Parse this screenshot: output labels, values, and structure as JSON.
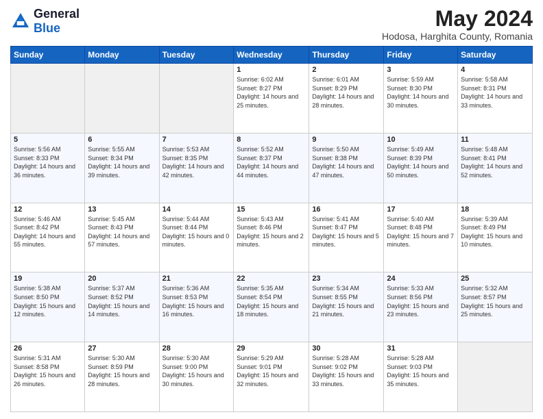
{
  "header": {
    "logo": {
      "general": "General",
      "blue": "Blue"
    },
    "title": "May 2024",
    "location": "Hodosa, Harghita County, Romania"
  },
  "weekdays": [
    "Sunday",
    "Monday",
    "Tuesday",
    "Wednesday",
    "Thursday",
    "Friday",
    "Saturday"
  ],
  "weeks": [
    [
      {
        "day": "",
        "info": ""
      },
      {
        "day": "",
        "info": ""
      },
      {
        "day": "",
        "info": ""
      },
      {
        "day": "1",
        "info": "Sunrise: 6:02 AM\nSunset: 8:27 PM\nDaylight: 14 hours and 25 minutes."
      },
      {
        "day": "2",
        "info": "Sunrise: 6:01 AM\nSunset: 8:29 PM\nDaylight: 14 hours and 28 minutes."
      },
      {
        "day": "3",
        "info": "Sunrise: 5:59 AM\nSunset: 8:30 PM\nDaylight: 14 hours and 30 minutes."
      },
      {
        "day": "4",
        "info": "Sunrise: 5:58 AM\nSunset: 8:31 PM\nDaylight: 14 hours and 33 minutes."
      }
    ],
    [
      {
        "day": "5",
        "info": "Sunrise: 5:56 AM\nSunset: 8:33 PM\nDaylight: 14 hours and 36 minutes."
      },
      {
        "day": "6",
        "info": "Sunrise: 5:55 AM\nSunset: 8:34 PM\nDaylight: 14 hours and 39 minutes."
      },
      {
        "day": "7",
        "info": "Sunrise: 5:53 AM\nSunset: 8:35 PM\nDaylight: 14 hours and 42 minutes."
      },
      {
        "day": "8",
        "info": "Sunrise: 5:52 AM\nSunset: 8:37 PM\nDaylight: 14 hours and 44 minutes."
      },
      {
        "day": "9",
        "info": "Sunrise: 5:50 AM\nSunset: 8:38 PM\nDaylight: 14 hours and 47 minutes."
      },
      {
        "day": "10",
        "info": "Sunrise: 5:49 AM\nSunset: 8:39 PM\nDaylight: 14 hours and 50 minutes."
      },
      {
        "day": "11",
        "info": "Sunrise: 5:48 AM\nSunset: 8:41 PM\nDaylight: 14 hours and 52 minutes."
      }
    ],
    [
      {
        "day": "12",
        "info": "Sunrise: 5:46 AM\nSunset: 8:42 PM\nDaylight: 14 hours and 55 minutes."
      },
      {
        "day": "13",
        "info": "Sunrise: 5:45 AM\nSunset: 8:43 PM\nDaylight: 14 hours and 57 minutes."
      },
      {
        "day": "14",
        "info": "Sunrise: 5:44 AM\nSunset: 8:44 PM\nDaylight: 15 hours and 0 minutes."
      },
      {
        "day": "15",
        "info": "Sunrise: 5:43 AM\nSunset: 8:46 PM\nDaylight: 15 hours and 2 minutes."
      },
      {
        "day": "16",
        "info": "Sunrise: 5:41 AM\nSunset: 8:47 PM\nDaylight: 15 hours and 5 minutes."
      },
      {
        "day": "17",
        "info": "Sunrise: 5:40 AM\nSunset: 8:48 PM\nDaylight: 15 hours and 7 minutes."
      },
      {
        "day": "18",
        "info": "Sunrise: 5:39 AM\nSunset: 8:49 PM\nDaylight: 15 hours and 10 minutes."
      }
    ],
    [
      {
        "day": "19",
        "info": "Sunrise: 5:38 AM\nSunset: 8:50 PM\nDaylight: 15 hours and 12 minutes."
      },
      {
        "day": "20",
        "info": "Sunrise: 5:37 AM\nSunset: 8:52 PM\nDaylight: 15 hours and 14 minutes."
      },
      {
        "day": "21",
        "info": "Sunrise: 5:36 AM\nSunset: 8:53 PM\nDaylight: 15 hours and 16 minutes."
      },
      {
        "day": "22",
        "info": "Sunrise: 5:35 AM\nSunset: 8:54 PM\nDaylight: 15 hours and 18 minutes."
      },
      {
        "day": "23",
        "info": "Sunrise: 5:34 AM\nSunset: 8:55 PM\nDaylight: 15 hours and 21 minutes."
      },
      {
        "day": "24",
        "info": "Sunrise: 5:33 AM\nSunset: 8:56 PM\nDaylight: 15 hours and 23 minutes."
      },
      {
        "day": "25",
        "info": "Sunrise: 5:32 AM\nSunset: 8:57 PM\nDaylight: 15 hours and 25 minutes."
      }
    ],
    [
      {
        "day": "26",
        "info": "Sunrise: 5:31 AM\nSunset: 8:58 PM\nDaylight: 15 hours and 26 minutes."
      },
      {
        "day": "27",
        "info": "Sunrise: 5:30 AM\nSunset: 8:59 PM\nDaylight: 15 hours and 28 minutes."
      },
      {
        "day": "28",
        "info": "Sunrise: 5:30 AM\nSunset: 9:00 PM\nDaylight: 15 hours and 30 minutes."
      },
      {
        "day": "29",
        "info": "Sunrise: 5:29 AM\nSunset: 9:01 PM\nDaylight: 15 hours and 32 minutes."
      },
      {
        "day": "30",
        "info": "Sunrise: 5:28 AM\nSunset: 9:02 PM\nDaylight: 15 hours and 33 minutes."
      },
      {
        "day": "31",
        "info": "Sunrise: 5:28 AM\nSunset: 9:03 PM\nDaylight: 15 hours and 35 minutes."
      },
      {
        "day": "",
        "info": ""
      }
    ]
  ]
}
